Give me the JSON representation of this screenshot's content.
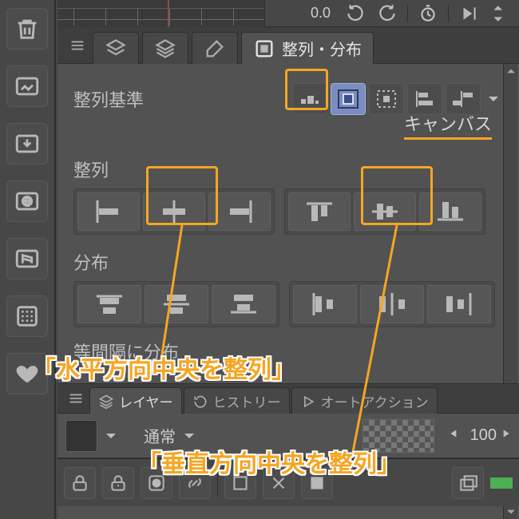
{
  "top": {
    "readout": "0.0"
  },
  "tabs": {
    "align_label": "整列・分布"
  },
  "panel": {
    "reference_label": "整列基準",
    "reference_value_name": "キャンバス",
    "align_label": "整列",
    "distribute_label": "分布",
    "equal_label": "等間隔に分布"
  },
  "lower_tabs": {
    "layer": "レイヤー",
    "history": "ヒストリー",
    "auto_action": "オートアクション"
  },
  "layer": {
    "blend_mode": "通常",
    "opacity": "100"
  },
  "annotations": {
    "h_center": "「水平方向中央を整列」",
    "v_center": "「垂直方向中央を整列」"
  },
  "icons": {
    "rail": [
      "trash",
      "image-folder",
      "import-folder",
      "globe-folder",
      "building-folder",
      "grid",
      "heart"
    ],
    "reference_options": [
      "auto",
      "canvas",
      "selection",
      "left-edge",
      "right-edge"
    ],
    "align_buttons": [
      "align-left",
      "align-h-center",
      "align-right",
      "align-top",
      "align-v-center",
      "align-bottom"
    ],
    "distribute_buttons": [
      "dist-top",
      "dist-v-center",
      "dist-bottom",
      "dist-left",
      "dist-h-center",
      "dist-right"
    ]
  }
}
